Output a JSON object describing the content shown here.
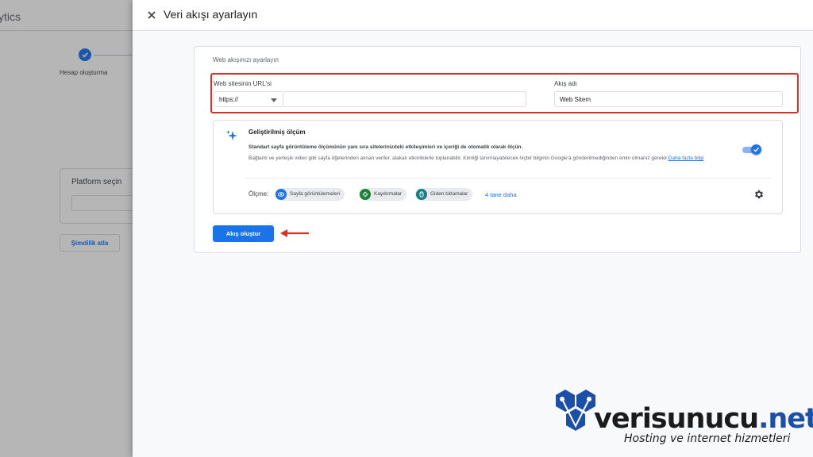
{
  "background": {
    "app_title": "ytics",
    "step_label": "Hesap oluşturma",
    "platform_title": "Platform seçin",
    "skip_button": "Şimdilik atla"
  },
  "drawer": {
    "title": "Veri akışı ayarlayın",
    "card_title": "Web akışınızı ayarlayın",
    "url": {
      "label": "Web sitesinin URL'si",
      "protocol": "https://",
      "value": ""
    },
    "stream_name": {
      "label": "Akış adı",
      "value": "Web Sitem"
    },
    "enhanced_measurement": {
      "title": "Geliştirilmiş ölçüm",
      "description_bold": "Standart sayfa görüntüleme ölçümünün yanı sıra sitelerinizdeki etkileşimleri ve içeriği de otomatik olarak ölçün.",
      "description": "Bağlantı ve yerleşik video gibi sayfa öğelerinden alınan veriler, alakalı etkinliklerle toplanabilir. Kimliği tanımlayabilecek hiçbir bilginin Google'a gönderilmediğinden emin olmanız gerekir.",
      "more_link": "Daha fazla bilgi",
      "enabled": true,
      "metrics_label": "Ölçme:",
      "metrics": [
        {
          "label": "Sayfa görüntülemeleri",
          "icon": "eye-icon",
          "color": "#1a73e8"
        },
        {
          "label": "Kaydırmalar",
          "icon": "scroll-icon",
          "color": "#188038"
        },
        {
          "label": "Giden tıklamalar",
          "icon": "click-icon",
          "color": "#137f84"
        }
      ],
      "more_metrics": "4 tane daha"
    },
    "create_button": "Akış oluştur"
  },
  "watermark": {
    "brand_main": "verisunucu",
    "brand_tld": ".net",
    "tagline": "Hosting ve internet hizmetleri"
  },
  "colors": {
    "primary": "#1a73e8",
    "highlight": "#d93025"
  }
}
